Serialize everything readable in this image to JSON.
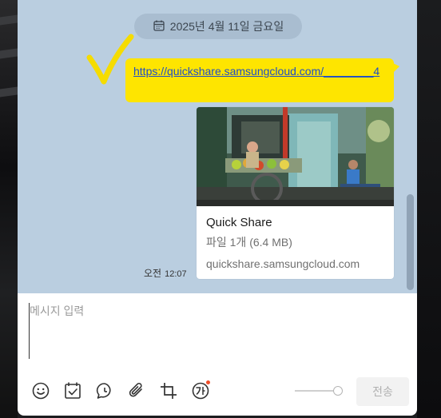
{
  "chat": {
    "date_label": "2025년 4월 11일 금요일",
    "message_link": "https://quickshare.samsungcloud.com/________4",
    "card": {
      "title": "Quick Share",
      "subtitle": "파일 1개 (6.4 MB)",
      "host": "quickshare.samsungcloud.com"
    },
    "time_ampm": "오전",
    "time": "12:07"
  },
  "composer": {
    "placeholder": "메시지 입력",
    "send_label": "전송"
  },
  "toolbar": {
    "icons": [
      "emoji-icon",
      "calendar-check-icon",
      "chat-bubble-icon",
      "paperclip-icon",
      "crop-icon",
      "text-style-icon"
    ]
  },
  "colors": {
    "chat_bg": "#bacee0",
    "bubble": "#fee500",
    "link": "#1e4ec8",
    "checkmark": "#f5dc00",
    "notify_dot": "#f04f2a"
  }
}
